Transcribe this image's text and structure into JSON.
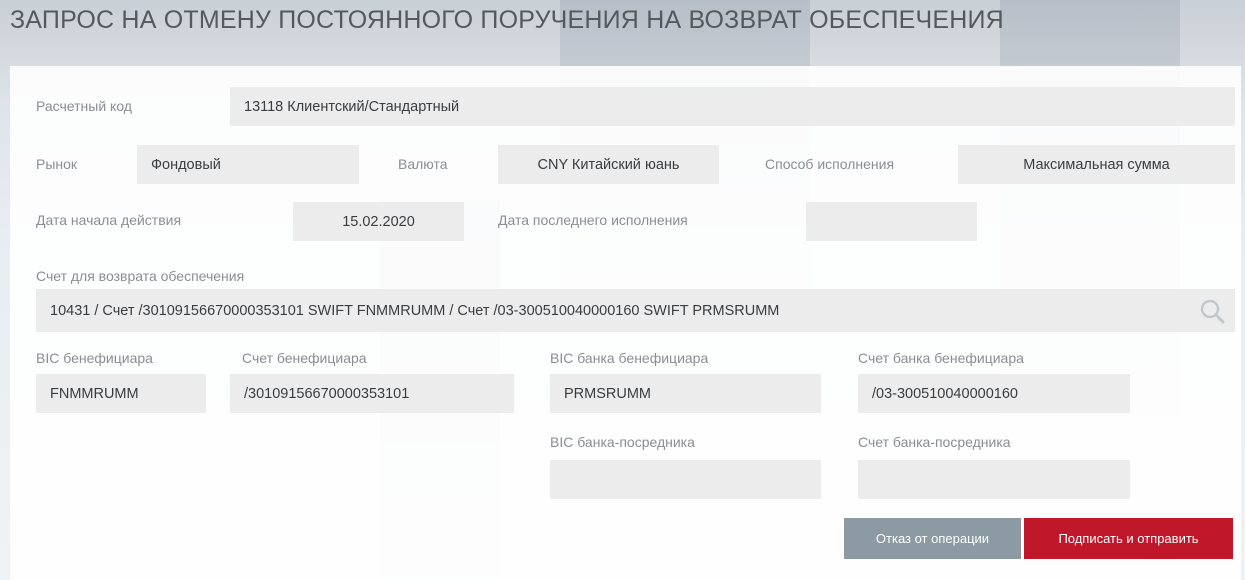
{
  "page": {
    "title": "ЗАПРОС НА ОТМЕНУ ПОСТОЯННОГО ПОРУЧЕНИЯ НА ВОЗВРАТ ОБЕСПЕЧЕНИЯ"
  },
  "form": {
    "settlement_code": {
      "label": "Расчетный код",
      "value": "13118 Клиентский/Стандартный"
    },
    "market": {
      "label": "Рынок",
      "value": "Фондовый"
    },
    "currency": {
      "label": "Валюта",
      "value": "CNY Китайский юань"
    },
    "execution_method": {
      "label": "Способ исполнения",
      "value": "Максимальная сумма"
    },
    "start_date": {
      "label": "Дата начала действия",
      "value": "15.02.2020"
    },
    "last_execution_date": {
      "label": "Дата последнего исполнения",
      "value": ""
    },
    "return_account": {
      "label": "Счет для возврата обеспечения",
      "value": "10431 / Счет /30109156670000353101 SWIFT FNMMRUMM / Счет /03-300510040000160 SWIFT PRMSRUMM",
      "search_icon": "search-icon"
    },
    "beneficiary_bic": {
      "label": "BIC бенефициара",
      "value": "FNMMRUMM"
    },
    "beneficiary_account": {
      "label": "Счет бенефициара",
      "value": "/30109156670000353101"
    },
    "beneficiary_bank_bic": {
      "label": "BIC банка бенефициара",
      "value": "PRMSRUMM"
    },
    "beneficiary_bank_account": {
      "label": "Счет банка бенефициара",
      "value": "/03-300510040000160"
    },
    "intermediary_bank_bic": {
      "label": "BIC банка-посредника",
      "value": ""
    },
    "intermediary_bank_account": {
      "label": "Счет банка-посредника",
      "value": ""
    }
  },
  "actions": {
    "cancel_label": "Отказ от операции",
    "submit_label": "Подписать и отправить"
  },
  "colors": {
    "accent": "#c0172b",
    "secondary_button": "#8c9aa4",
    "field_background": "#ececed",
    "label_text": "#8a8e93"
  }
}
